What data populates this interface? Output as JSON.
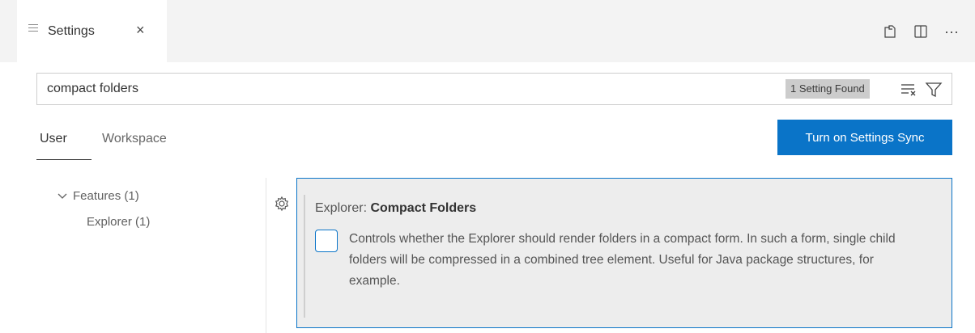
{
  "tab": {
    "title": "Settings",
    "close": "×"
  },
  "tab_actions": [
    {
      "name": "open-settings-json-icon"
    },
    {
      "name": "split-editor-icon"
    },
    {
      "name": "more-actions-icon",
      "glyph": "···"
    }
  ],
  "search": {
    "value": "compact folders",
    "placeholder": "Search settings",
    "result_count": "1 Setting Found",
    "clear_icon": "clear-filter-icon",
    "filter_icon": "filter-icon"
  },
  "scopes": {
    "user": "User",
    "workspace": "Workspace",
    "active": "User"
  },
  "sync_button": "Turn on Settings Sync",
  "toc": [
    {
      "label": "Features (1)",
      "expanded": true,
      "icon": "chevron-down-icon"
    },
    {
      "label": "Explorer (1)"
    }
  ],
  "setting": {
    "category": "Explorer: ",
    "name": "Compact Folders",
    "checked": false,
    "description": "Controls whether the Explorer should render folders in a compact form. In such a form, single child folders will be compressed in a combined tree element. Useful for Java package structures, for example.",
    "gear_icon": "gear-icon"
  },
  "colors": {
    "accent": "#0a74c8",
    "tabbar_bg": "#f3f3f3",
    "setting_bg": "#ededed"
  }
}
